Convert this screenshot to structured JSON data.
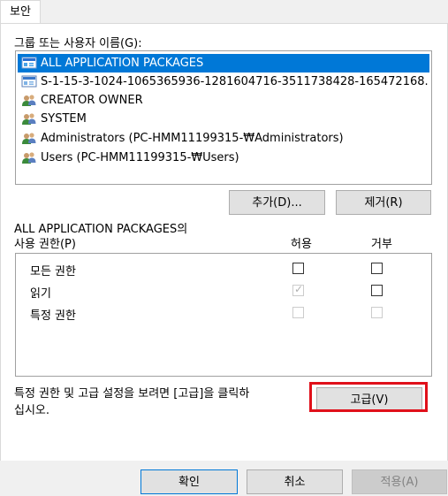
{
  "tab": {
    "label": "보안"
  },
  "group_label": "그룹 또는 사용자 이름(G):",
  "principals": [
    {
      "name": "ALL APPLICATION PACKAGES",
      "icon": "app-packages-icon",
      "selected": true
    },
    {
      "name": "S-1-15-3-1024-1065365936-1281604716-3511738428-165472168...",
      "icon": "sid-icon",
      "selected": false
    },
    {
      "name": "CREATOR OWNER",
      "icon": "users-group-icon",
      "selected": false
    },
    {
      "name": "SYSTEM",
      "icon": "users-group-icon",
      "selected": false
    },
    {
      "name": "Administrators (PC-HMM11199315-₩Administrators)",
      "icon": "users-group-icon",
      "selected": false
    },
    {
      "name": "Users (PC-HMM11199315-₩Users)",
      "icon": "users-group-icon",
      "selected": false
    }
  ],
  "buttons": {
    "add": "추가(D)...",
    "remove": "제거(R)",
    "advanced": "고급(V)"
  },
  "permissions_heading_line1": "ALL APPLICATION PACKAGES의",
  "permissions_heading_line2": "사용 권한(P)",
  "columns": {
    "allow": "허용",
    "deny": "거부"
  },
  "permissions": [
    {
      "name": "모든 권한",
      "allow": false,
      "allow_disabled": false,
      "deny": false,
      "deny_disabled": false
    },
    {
      "name": "읽기",
      "allow": true,
      "allow_disabled": true,
      "deny": false,
      "deny_disabled": false
    },
    {
      "name": "특정 권한",
      "allow": false,
      "allow_disabled": true,
      "deny": false,
      "deny_disabled": true
    }
  ],
  "advanced_hint_line1": "특정 권한 및 고급 설정을 보려면 [고급]을 클릭하",
  "advanced_hint_line2": "십시오.",
  "footer": {
    "ok": "확인",
    "cancel": "취소",
    "apply": "적용(A)"
  },
  "colors": {
    "selection": "#0078d7",
    "highlight_border": "#e0101a"
  }
}
